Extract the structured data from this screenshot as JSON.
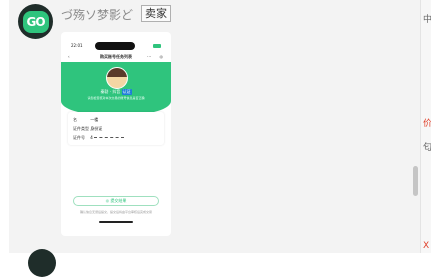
{
  "message": {
    "sender_name": "づ殇ソ梦影ど",
    "sender_tag": "卖家",
    "avatar_text": "GO"
  },
  "screenshot": {
    "time": "22:01",
    "page_title": "购买账号任务列表",
    "back_glyph": "‹",
    "menu_glyph": "···",
    "ring_glyph": "◎",
    "user_name": "秦勃 · 抖音",
    "user_badge": "认证",
    "user_subtitle": "请您检查核对本次交易的账号信息是否正确",
    "fields": [
      {
        "label": "名",
        "value": "一楼"
      },
      {
        "label": "证件类型",
        "value": "身份证"
      },
      {
        "label": "证件号",
        "value": "4"
      }
    ],
    "submit_label": "◎ 提交结果",
    "tip": "确认信息无误后提交，提交后将由平台审核后完成交易"
  },
  "right_panel": {
    "t1": "中",
    "t2": "价",
    "t3": "匂",
    "t4": "X"
  },
  "colors": {
    "brand_green": "#2fc47d",
    "accent_red": "#e0402a"
  }
}
